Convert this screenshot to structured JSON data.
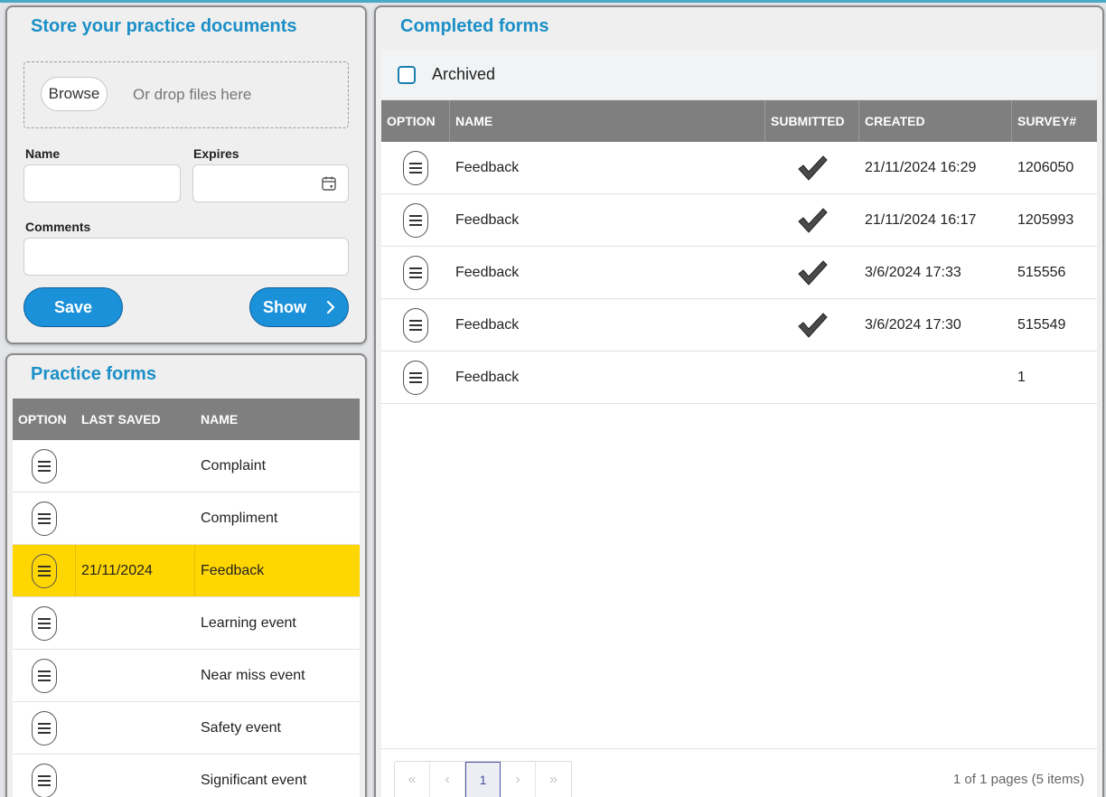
{
  "store": {
    "title": "Store your practice documents",
    "browse_label": "Browse",
    "drop_text": "Or drop files here",
    "name_label": "Name",
    "expires_label": "Expires",
    "comments_label": "Comments",
    "save_label": "Save",
    "show_label": "Show",
    "name_value": "",
    "expires_value": "",
    "comments_value": ""
  },
  "practice": {
    "title": "Practice forms",
    "columns": [
      "OPTION",
      "LAST SAVED",
      "NAME"
    ],
    "rows": [
      {
        "last_saved": "",
        "name": "Complaint"
      },
      {
        "last_saved": "",
        "name": "Compliment"
      },
      {
        "last_saved": "21/11/2024",
        "name": "Feedback",
        "selected": true
      },
      {
        "last_saved": "",
        "name": "Learning event"
      },
      {
        "last_saved": "",
        "name": "Near miss event"
      },
      {
        "last_saved": "",
        "name": "Safety event"
      },
      {
        "last_saved": "",
        "name": "Significant event"
      }
    ]
  },
  "completed": {
    "title": "Completed forms",
    "archived_label": "Archived",
    "archived_checked": false,
    "columns": [
      "OPTION",
      "NAME",
      "SUBMITTED",
      "CREATED",
      "SURVEY#"
    ],
    "rows": [
      {
        "name": "Feedback",
        "submitted": true,
        "created": "21/11/2024 16:29",
        "survey": "1206050"
      },
      {
        "name": "Feedback",
        "submitted": true,
        "created": "21/11/2024 16:17",
        "survey": "1205993"
      },
      {
        "name": "Feedback",
        "submitted": true,
        "created": "3/6/2024 17:33",
        "survey": "515556"
      },
      {
        "name": "Feedback",
        "submitted": true,
        "created": "3/6/2024 17:30",
        "survey": "515549"
      },
      {
        "name": "Feedback",
        "submitted": false,
        "created": "",
        "survey": "1"
      }
    ],
    "pager": {
      "first": "«",
      "prev": "‹",
      "current_page": "1",
      "next": "›",
      "last": "»",
      "info": "1 of 1 pages (5 items)"
    }
  },
  "colors": {
    "accent": "#1b8fc7",
    "button": "#1a91d8",
    "header": "#7f7f7f",
    "selected_row": "#ffd600"
  }
}
